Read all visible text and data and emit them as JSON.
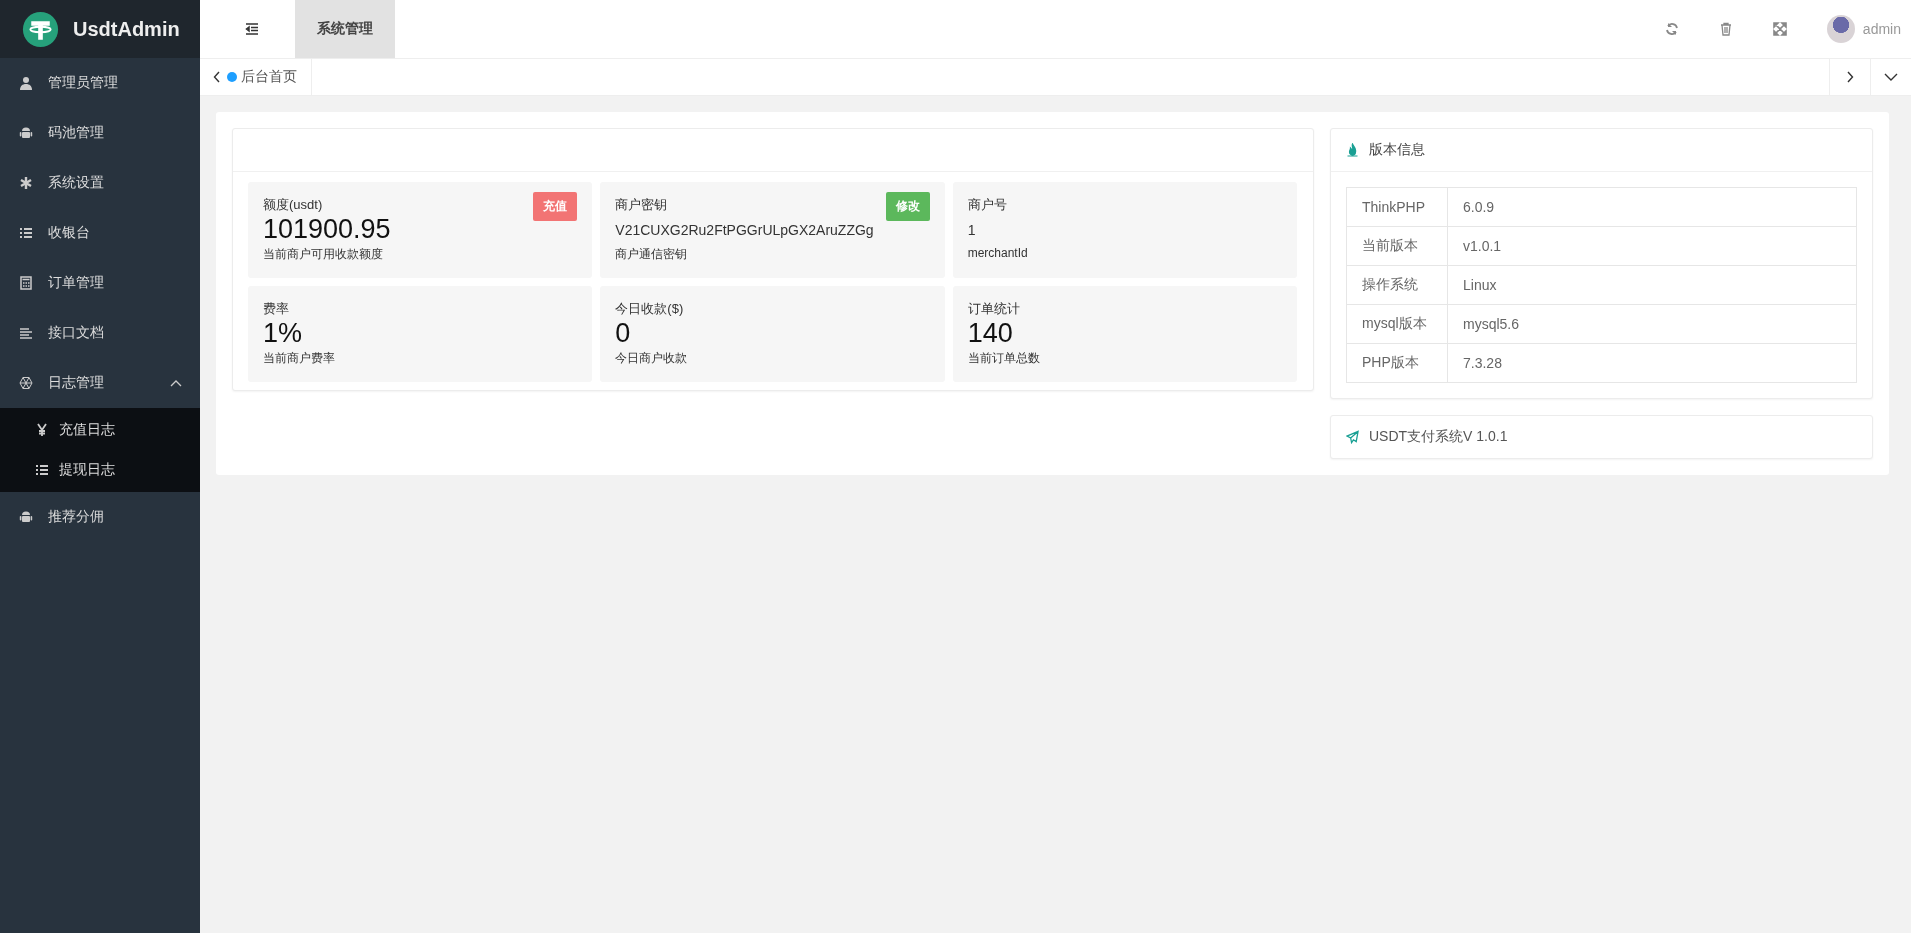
{
  "brand": {
    "title": "UsdtAdmin"
  },
  "sidebar": {
    "items": [
      {
        "label": "管理员管理"
      },
      {
        "label": "码池管理"
      },
      {
        "label": "系统设置"
      },
      {
        "label": "收银台"
      },
      {
        "label": "订单管理"
      },
      {
        "label": "接口文档"
      },
      {
        "label": "日志管理",
        "expanded": true,
        "children": [
          {
            "label": "充值日志"
          },
          {
            "label": "提现日志"
          }
        ]
      },
      {
        "label": "推荐分佣"
      }
    ]
  },
  "header": {
    "tabs": [
      {
        "label": "系统管理",
        "selected": true
      }
    ],
    "user": {
      "name": "admin"
    }
  },
  "breadcrumb": {
    "label": "后台首页"
  },
  "stats": [
    {
      "label": "额度(usdt)",
      "value": "101900.95",
      "caption": "当前商户可用收款额度",
      "action": {
        "label": "充值",
        "color": "#f27474"
      }
    },
    {
      "label": "商户密钥",
      "value": "V21CUXG2Ru2FtPGGrULpGX2AruZZGg",
      "caption": "商户通信密钥",
      "kind": "small",
      "action": {
        "label": "修改",
        "color": "#5cb85c"
      }
    },
    {
      "label": "商户号",
      "value": "1",
      "caption": "merchantId",
      "kind": "small"
    },
    {
      "label": "费率",
      "value": "1%",
      "caption": "当前商户费率"
    },
    {
      "label": "今日收款($)",
      "value": "0",
      "caption": "今日商户收款"
    },
    {
      "label": "订单统计",
      "value": "140",
      "caption": "当前订单总数"
    }
  ],
  "version_info": {
    "title": "版本信息",
    "rows": [
      {
        "name": "ThinkPHP",
        "value": "6.0.9"
      },
      {
        "name": "当前版本",
        "value": "v1.0.1"
      },
      {
        "name": "操作系统",
        "value": "Linux"
      },
      {
        "name": "mysql版本",
        "value": "mysql5.6"
      },
      {
        "name": "PHP版本",
        "value": "7.3.28"
      }
    ]
  },
  "footer_card": {
    "text": "USDT支付系统V 1.0.1"
  }
}
